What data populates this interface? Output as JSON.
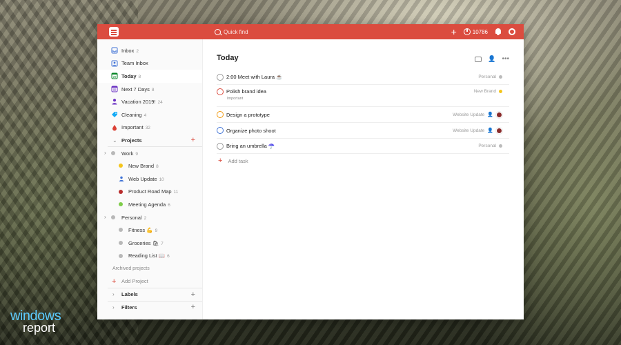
{
  "topbar": {
    "search_placeholder": "Quick find",
    "add": "+",
    "karma": "10786"
  },
  "sidebar": {
    "inbox": {
      "label": "Inbox",
      "count": "2"
    },
    "team_inbox": {
      "label": "Team Inbox"
    },
    "today": {
      "label": "Today",
      "count": "8"
    },
    "next7": {
      "label": "Next 7 Days",
      "count": "8"
    },
    "vacation": {
      "label": "Vacation 2019!",
      "count": "24"
    },
    "cleaning": {
      "label": "Cleaning",
      "count": "4"
    },
    "important": {
      "label": "Important",
      "count": "32"
    },
    "projects_header": "Projects",
    "projects": [
      {
        "label": "Work",
        "count": "9"
      },
      {
        "label": "New Brand",
        "count": "8",
        "color": "#f4c51c"
      },
      {
        "label": "Web Update",
        "count": "10",
        "color": "#4073d6"
      },
      {
        "label": "Product Road Map",
        "count": "11",
        "color": "#b82c2c"
      },
      {
        "label": "Meeting Agenda",
        "count": "6",
        "color": "#7ecc49"
      },
      {
        "label": "Personal",
        "count": "2"
      },
      {
        "label": "Fitness 💪",
        "count": "9"
      },
      {
        "label": "Groceries 🛍",
        "count": "7"
      },
      {
        "label": "Reading List 📖",
        "count": "6"
      }
    ],
    "archived": "Archived projects",
    "add_project": "Add Project",
    "labels": "Labels",
    "filters": "Filters"
  },
  "main": {
    "title": "Today",
    "tasks": [
      {
        "text": "2:00 Meet with Laura ☕",
        "project": "Personal",
        "color": "#bbbbbb",
        "circle": "#999999"
      },
      {
        "text": "Polish brand idea",
        "note": "Important",
        "project": "New Brand",
        "color": "#f4c51c",
        "circle": "#db4c3f"
      },
      {
        "text": "Design a prototype",
        "project": "Website Update",
        "color": "#4073d6",
        "circle": "#f29a0e"
      },
      {
        "text": "Organize photo shoot",
        "project": "Website Update",
        "color": "#4073d6",
        "circle": "#4073d6"
      },
      {
        "text": "Bring an umbrella ☂️",
        "project": "Personal",
        "color": "#bbbbbb",
        "circle": "#999999"
      }
    ],
    "add_task": "Add task"
  },
  "watermark": {
    "line1": "windows",
    "line2": "report"
  }
}
